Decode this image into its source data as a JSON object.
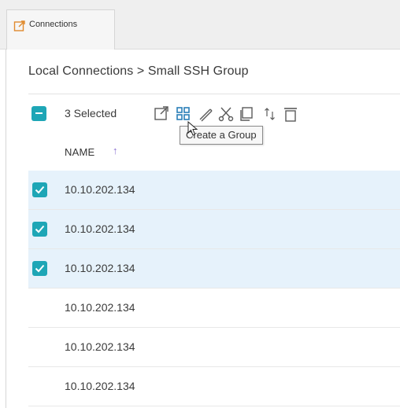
{
  "tab": {
    "label": "Connections",
    "icon": "external-link-icon",
    "accent": "#e08b2e"
  },
  "breadcrumb": {
    "text": "Local Connections > Small SSH Group"
  },
  "toolbar": {
    "selected_text": "3 Selected",
    "tooltip": "Create a Group",
    "icons": [
      "open-icon",
      "create-group-icon",
      "edit-icon",
      "cut-icon",
      "copy-icon",
      "sort-icon",
      "delete-icon"
    ],
    "accent": "#1ea6b6"
  },
  "table": {
    "column_header": "NAME",
    "sort_direction": "ascending",
    "sort_color": "#8a6fd1",
    "rows": [
      {
        "name": "10.10.202.134",
        "selected": true
      },
      {
        "name": "10.10.202.134",
        "selected": true
      },
      {
        "name": "10.10.202.134",
        "selected": true
      },
      {
        "name": "10.10.202.134",
        "selected": false
      },
      {
        "name": "10.10.202.134",
        "selected": false
      },
      {
        "name": "10.10.202.134",
        "selected": false
      }
    ]
  }
}
